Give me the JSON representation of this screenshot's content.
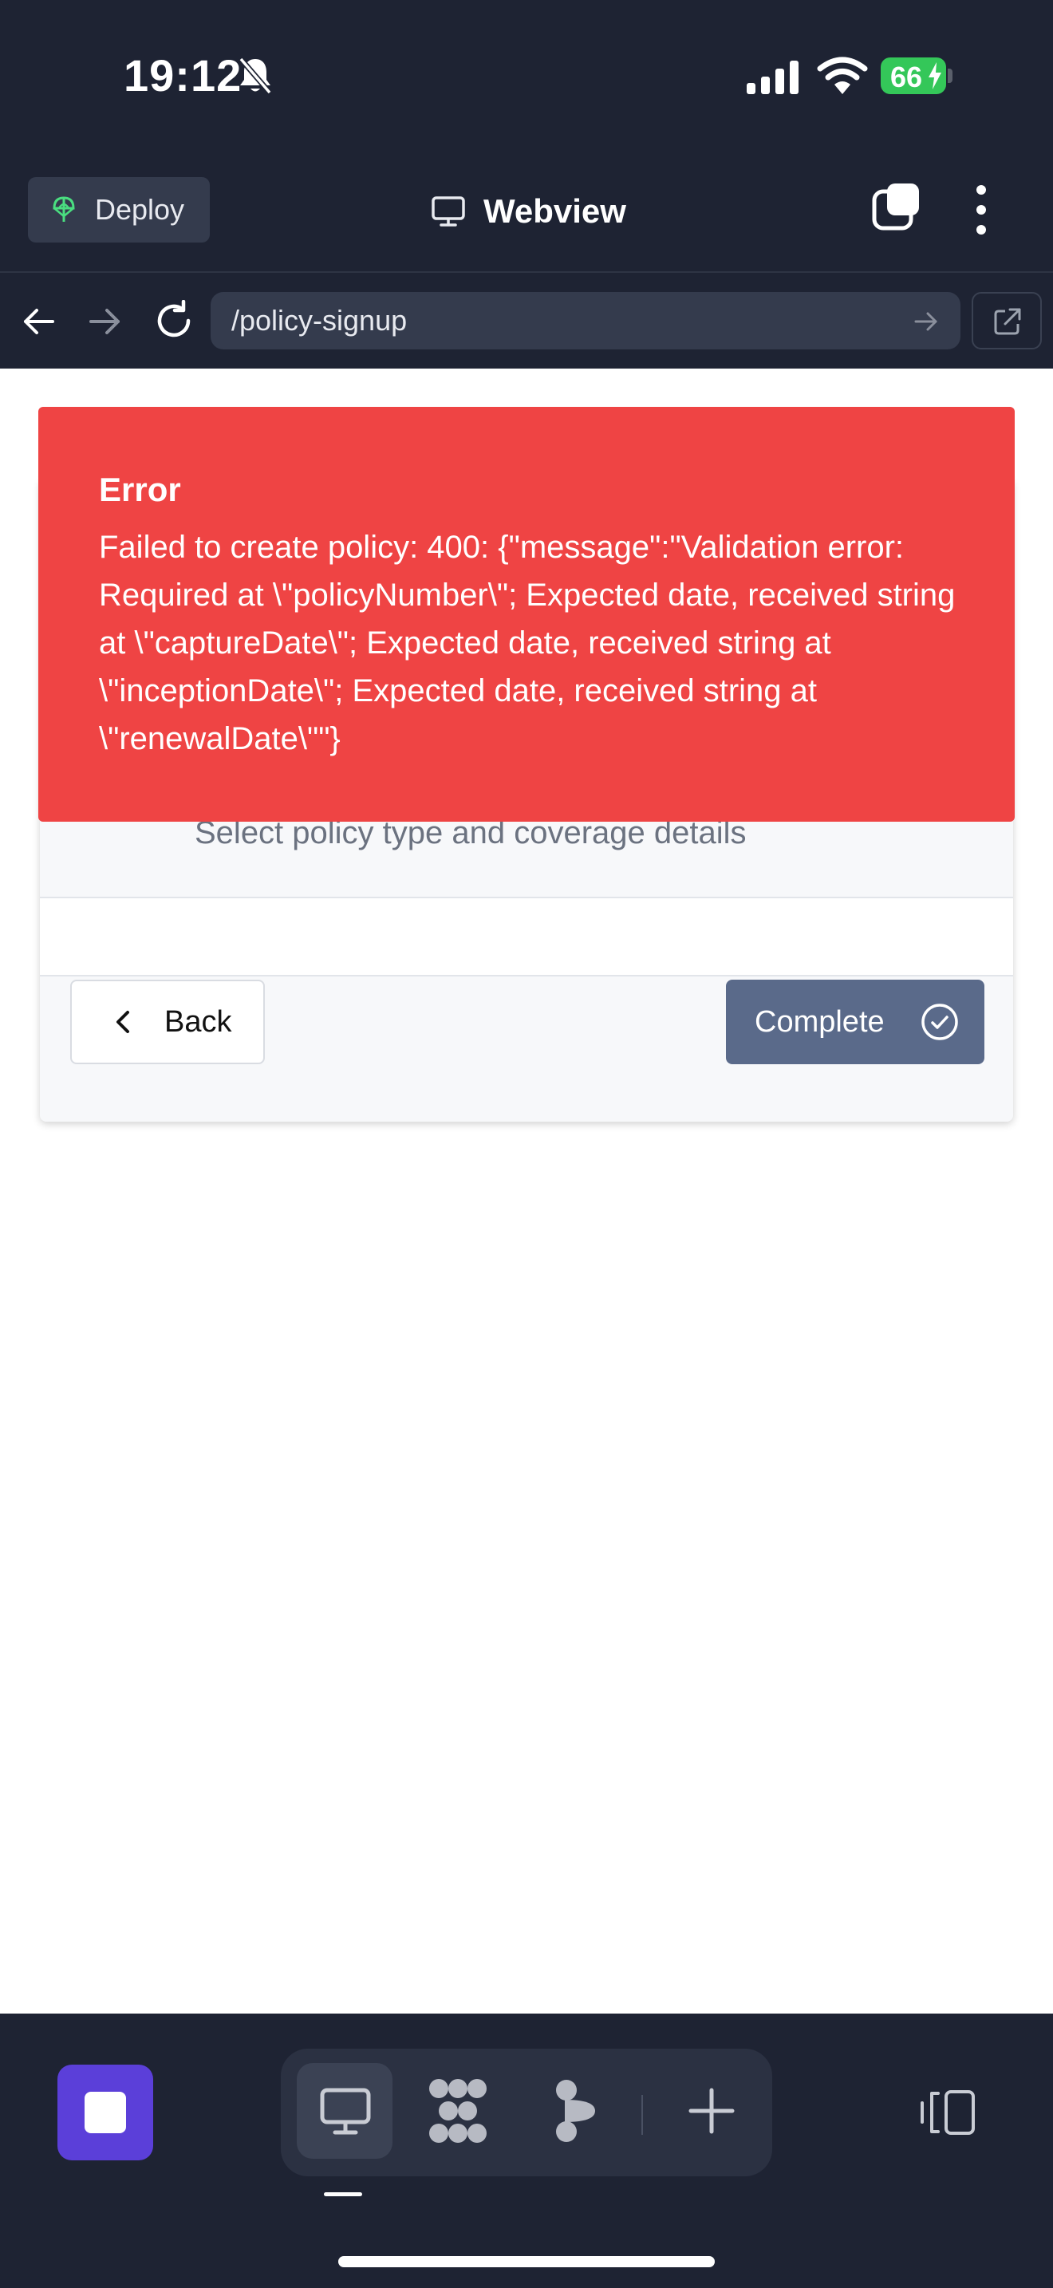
{
  "status_bar": {
    "time": "19:12",
    "battery": "66"
  },
  "header": {
    "deploy_label": "Deploy",
    "title": "Webview"
  },
  "url_bar": {
    "path": "/policy-signup"
  },
  "step": {
    "description": "Select policy type and coverage details"
  },
  "actions": {
    "back_label": "Back",
    "complete_label": "Complete"
  },
  "error": {
    "title": "Error",
    "message": "Failed to create policy: 400: {\"message\":\"Validation error: Required at \\\"policyNumber\\\"; Expected date, received string at \\\"captureDate\\\"; Expected date, received string at \\\"inceptionDate\\\"; Expected date, received string at \\\"renewalDate\\\"\"}"
  },
  "colors": {
    "chrome_bg": "#1e2333",
    "error_bg": "#ef4444",
    "complete_btn": "#5a6a8a",
    "stop_btn": "#5b3fd9",
    "battery": "#34c759"
  },
  "icons": [
    "bell-off-icon",
    "signal-icon",
    "wifi-icon",
    "deploy-icon",
    "monitor-icon",
    "tabs-icon",
    "kebab-icon",
    "back-arrow-icon",
    "forward-arrow-icon",
    "reload-icon",
    "go-arrow-icon",
    "open-external-icon",
    "chevron-left-icon",
    "check-circle-icon",
    "stop-icon",
    "monitor-icon",
    "grid-icon",
    "ai-icon",
    "plus-icon",
    "panel-icon"
  ]
}
